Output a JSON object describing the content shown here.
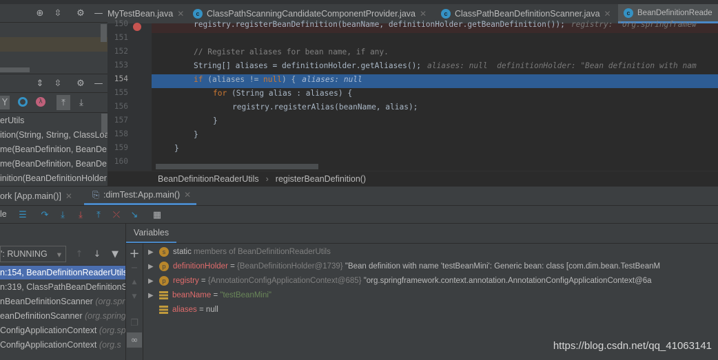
{
  "editor_tabs": [
    {
      "label": "MyTestBean.java",
      "icon": "class-icon"
    },
    {
      "label": "ClassPathScanningCandidateComponentProvider.java",
      "icon": "class-icon"
    },
    {
      "label": "ClassPathBeanDefinitionScanner.java",
      "icon": "class-icon"
    },
    {
      "label": "BeanDefinitionReade",
      "icon": "class-icon",
      "active": true
    }
  ],
  "code": {
    "lines": [
      {
        "num": "150",
        "text": "registry.registerBeanDefinition(beanName, definitionHolder.getBeanDefinition());",
        "hint": "registry: \"org.springframew",
        "breakpoint": true
      },
      {
        "num": "151",
        "text": ""
      },
      {
        "num": "152",
        "text": "// Register aliases for bean name, if any."
      },
      {
        "num": "153",
        "text": "String[] aliases = definitionHolder.getAliases();",
        "hint": "aliases: null  definitionHolder: \"Bean definition with nam"
      },
      {
        "num": "154",
        "kw": "if",
        "text": " (aliases != ",
        "kw2": "null",
        "text2": ") {",
        "hint": "aliases: null",
        "current": true
      },
      {
        "num": "155",
        "kw": "for",
        "text": " (String alias : aliases) {"
      },
      {
        "num": "156",
        "text": "registry.registerAlias(beanName, alias);"
      },
      {
        "num": "157",
        "text": "}"
      },
      {
        "num": "158",
        "text": "}"
      },
      {
        "num": "159",
        "text": "}"
      },
      {
        "num": "160",
        "text": ""
      }
    ]
  },
  "breadcrumb": [
    "BeanDefinitionReaderUtils",
    "registerBeanDefinition()"
  ],
  "structure_items": [
    "erUtils",
    "ition(String, String, ClassLoa",
    "me(BeanDefinition, BeanDe",
    "me(BeanDefinition, BeanDe",
    "inition(BeanDefinitionHolder"
  ],
  "debug_tabs": [
    {
      "label": "ork [App.main()]"
    },
    {
      "label": ":dimTest:App.main()",
      "active": true
    }
  ],
  "debug_toolbar": {
    "console_label": "le"
  },
  "frames": {
    "thread": "': RUNNING",
    "items": [
      {
        "text": "n:154, BeanDefinitionReaderUtils",
        "pkg": "",
        "selected": true
      },
      {
        "text": "n:319, ClassPathBeanDefinitionSc",
        "pkg": ""
      },
      {
        "text": "nBeanDefinitionScanner",
        "pkg": "(org.spr"
      },
      {
        "text": "eanDefinitionScanner",
        "pkg": "(org.spring"
      },
      {
        "text": "ConfigApplicationContext",
        "pkg": "(org.sp"
      },
      {
        "text": "ConfigApplicationContext",
        "pkg": "(org.s"
      }
    ]
  },
  "variables": {
    "header": "Variables",
    "items": [
      {
        "badge": "s",
        "name": "static",
        "value": "members of BeanDefinitionReaderUtils",
        "expandable": true
      },
      {
        "badge": "p",
        "name": "definitionHolder",
        "eq": " = ",
        "ref": "{BeanDefinitionHolder@1739}",
        "value": "\"Bean definition with name 'testBeanMini': Generic bean: class [com.dim.bean.TestBeanM",
        "expandable": true
      },
      {
        "badge": "p",
        "name": "registry",
        "eq": " = ",
        "ref": "{AnnotationConfigApplicationContext@685}",
        "value": "\"org.springframework.context.annotation.AnnotationConfigApplicationContext@6a",
        "expandable": true
      },
      {
        "badge": "field",
        "name": "beanName",
        "eq": " = ",
        "value": "\"testBeanMini\"",
        "expandable": true
      },
      {
        "badge": "field",
        "name": "aliases",
        "eq": " = ",
        "value": "null",
        "expandable": false
      }
    ]
  },
  "watermark": "https://blog.csdn.net/qq_41063141"
}
